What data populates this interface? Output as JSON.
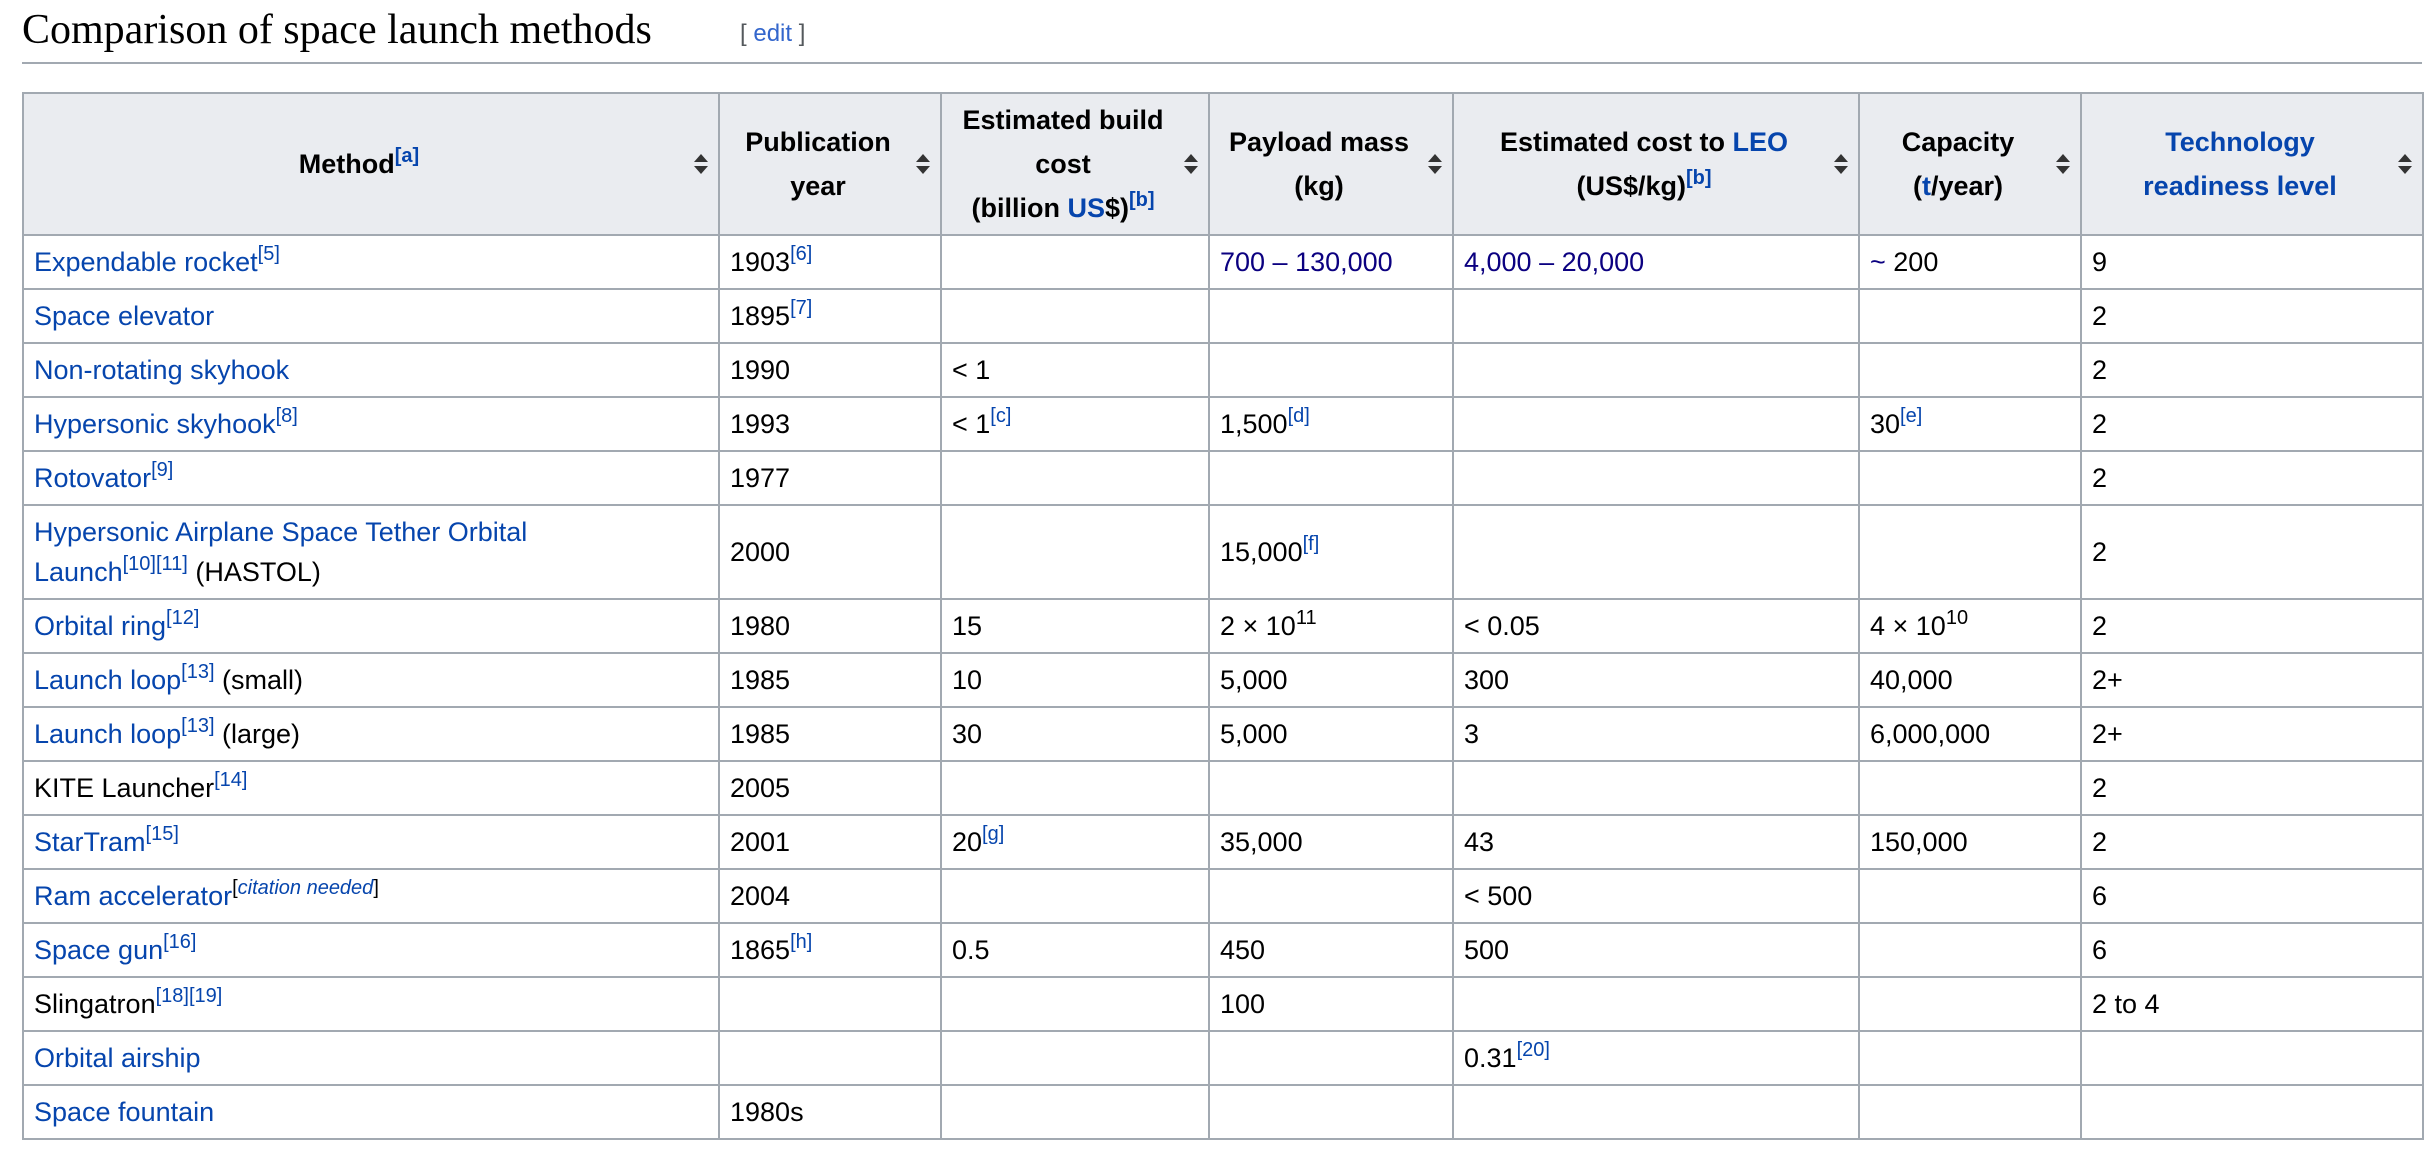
{
  "section": {
    "title": "Comparison of space launch methods",
    "edit_open": "[ ",
    "edit_label": "edit",
    "edit_close": " ]"
  },
  "headers": {
    "method": {
      "label": "Method",
      "ref": "[a]"
    },
    "year": {
      "line1": "Publication",
      "line2": "year"
    },
    "build_cost": {
      "line1": "Estimated build",
      "line2": "cost",
      "pre": "(billion ",
      "link": "US",
      "post": "$)",
      "ref": "[b]"
    },
    "payload": {
      "line1": "Payload mass",
      "line2": "(kg)"
    },
    "leo_cost": {
      "pre": "Estimated cost to ",
      "link": "LEO",
      "line2": "(US$/kg)",
      "ref": "[b]"
    },
    "capacity": {
      "line1": "Capacity",
      "pre": "(",
      "link": "t",
      "post": "/year)"
    },
    "trl": {
      "line1": "Technology",
      "line2": "readiness level"
    }
  },
  "rows": [
    {
      "method": {
        "link": "Expendable rocket",
        "ref": "[5]"
      },
      "year": "1903",
      "year_ref": "[6]",
      "payload": "700 – 130,000",
      "leo": "4,000 – 20,000",
      "capacity_prefix": "~",
      "capacity": " 200",
      "trl": "9"
    },
    {
      "method": {
        "link": "Space elevator"
      },
      "year": "1895",
      "year_ref": "[7]",
      "trl": "2"
    },
    {
      "method": {
        "link": "Non-rotating skyhook"
      },
      "year": "1990",
      "build": "< 1",
      "trl": "2"
    },
    {
      "method": {
        "link": "Hypersonic skyhook",
        "ref": "[8]"
      },
      "year": "1993",
      "build": "< 1",
      "build_ref": "[c]",
      "payload": "1,500",
      "payload_ref": "[d]",
      "capacity": "30",
      "capacity_ref": "[e]",
      "trl": "2"
    },
    {
      "method": {
        "link": "Rotovator",
        "ref": "[9]"
      },
      "year": "1977",
      "trl": "2"
    },
    {
      "method": {
        "link_line1": "Hypersonic Airplane Space Tether Orbital",
        "link_line2": "Launch",
        "ref1": "[10]",
        "ref2": "[11]",
        "suffix": " (HASTOL)"
      },
      "year": "2000",
      "payload": "15,000",
      "payload_ref": "[f]",
      "trl": "2"
    },
    {
      "method": {
        "link": "Orbital ring",
        "ref": "[12]"
      },
      "year": "1980",
      "build": "15",
      "payload_base": "2 × 10",
      "payload_exp": "11",
      "leo": "< 0.05",
      "capacity_base": "4 × 10",
      "capacity_exp": "10",
      "trl": "2"
    },
    {
      "method": {
        "link": "Launch loop",
        "ref": "[13]",
        "suffix": " (small)"
      },
      "year": "1985",
      "build": "10",
      "payload": "5,000",
      "leo": "300",
      "capacity": "40,000",
      "trl": "2+"
    },
    {
      "method": {
        "link": "Launch loop",
        "ref": "[13]",
        "suffix": " (large)"
      },
      "year": "1985",
      "build": "30",
      "payload": "5,000",
      "leo": "3",
      "capacity": "6,000,000",
      "trl": "2+"
    },
    {
      "method": {
        "text": "KITE Launcher",
        "ref": "[14]"
      },
      "year": "2005",
      "trl": "2"
    },
    {
      "method": {
        "link": "StarTram",
        "ref": "[15]"
      },
      "year": "2001",
      "build": "20",
      "build_ref": "[g]",
      "payload": "35,000",
      "leo": "43",
      "capacity": "150,000",
      "trl": "2"
    },
    {
      "method": {
        "link": "Ram accelerator",
        "cn_open": "[",
        "cn": "citation needed",
        "cn_close": "]"
      },
      "year": "2004",
      "leo": "< 500",
      "trl": "6"
    },
    {
      "method": {
        "link": "Space gun",
        "ref": "[16]"
      },
      "year": "1865",
      "year_ref": "[h]",
      "build": "0.5",
      "payload": "450",
      "leo": "500",
      "trl": "6"
    },
    {
      "method": {
        "text": "Slingatron",
        "ref1": "[18]",
        "ref2": "[19]"
      },
      "payload": "100",
      "trl": "2 to 4"
    },
    {
      "method": {
        "link": "Orbital airship"
      },
      "leo": "0.31",
      "leo_ref": "[20]"
    },
    {
      "method": {
        "link": "Space fountain"
      },
      "year": "1980s"
    }
  ]
}
